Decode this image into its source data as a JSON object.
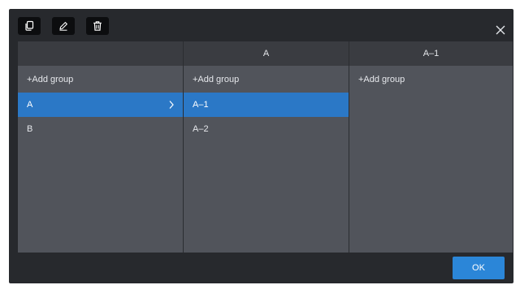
{
  "toolbar": {
    "buttons": [
      {
        "icon": "copy-icon"
      },
      {
        "icon": "edit-pencil-icon"
      },
      {
        "icon": "trash-icon"
      }
    ],
    "close_icon": "close-icon"
  },
  "columns": [
    {
      "header": "",
      "add_label": "+Add group",
      "items": [
        {
          "label": "A",
          "selected": true,
          "has_children": true
        },
        {
          "label": "B",
          "selected": false,
          "has_children": false
        }
      ]
    },
    {
      "header": "A",
      "add_label": "+Add group",
      "items": [
        {
          "label": "A–1",
          "selected": true
        },
        {
          "label": "A–2",
          "selected": false
        }
      ]
    },
    {
      "header": "A–1",
      "add_label": "+Add group",
      "items": []
    }
  ],
  "footer": {
    "ok_label": "OK"
  },
  "colors": {
    "dialog_bg": "#27292d",
    "column_bg": "#51545b",
    "header_bg": "#3a3c41",
    "selected_bg": "#2b78c6",
    "ok_bg": "#2b86d8"
  }
}
